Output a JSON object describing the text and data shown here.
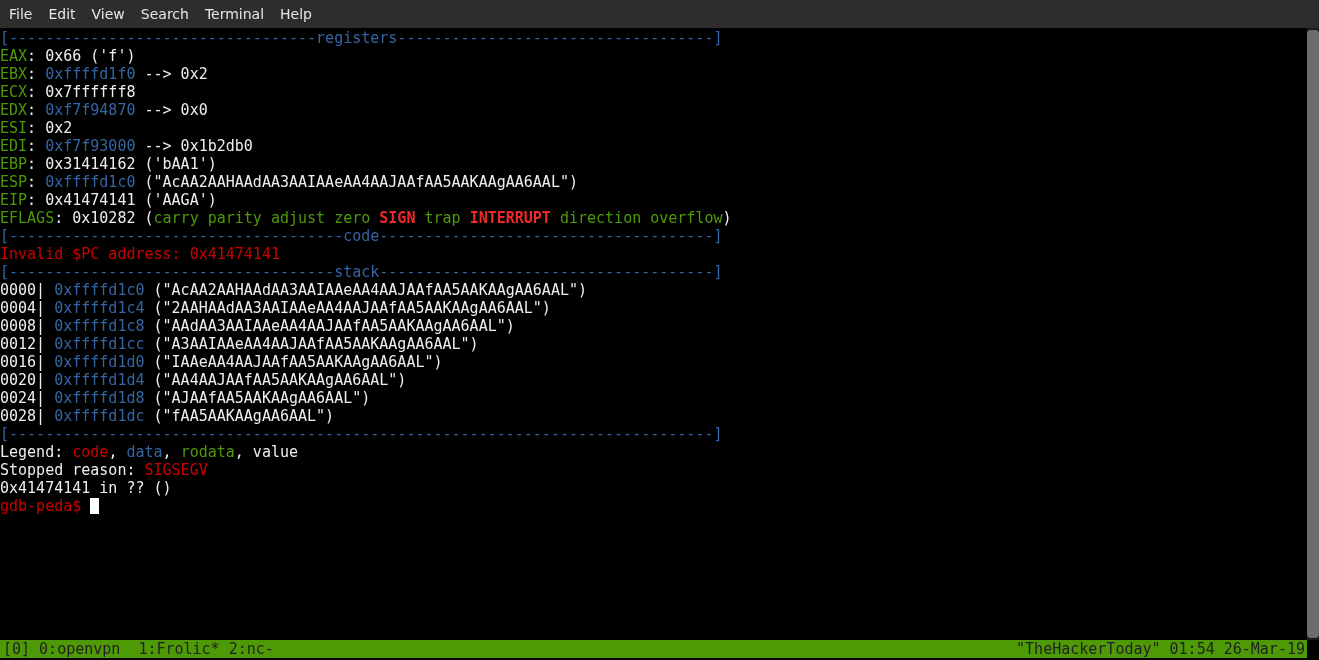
{
  "menu": [
    "File",
    "Edit",
    "View",
    "Search",
    "Terminal",
    "Help"
  ],
  "lines": [
    {
      "kind": "rule",
      "segments": [
        {
          "kind": "data",
          "text": "[----------------------------------"
        },
        {
          "kind": "data",
          "text": "registers"
        },
        {
          "kind": "data",
          "text": "-----------------------------------]"
        }
      ]
    },
    {
      "kind": "text",
      "segments": [
        {
          "kind": "rodata",
          "text": "EAX"
        },
        {
          "kind": "plain",
          "text": ": 0x66 ('f')"
        }
      ]
    },
    {
      "kind": "text",
      "segments": [
        {
          "kind": "rodata",
          "text": "EBX"
        },
        {
          "kind": "plain",
          "text": ": "
        },
        {
          "kind": "data",
          "text": "0xffffd1f0"
        },
        {
          "kind": "plain",
          "text": " --> 0x2"
        }
      ]
    },
    {
      "kind": "text",
      "segments": [
        {
          "kind": "rodata",
          "text": "ECX"
        },
        {
          "kind": "plain",
          "text": ": 0x7ffffff8"
        }
      ]
    },
    {
      "kind": "text",
      "segments": [
        {
          "kind": "rodata",
          "text": "EDX"
        },
        {
          "kind": "plain",
          "text": ": "
        },
        {
          "kind": "data",
          "text": "0xf7f94870"
        },
        {
          "kind": "plain",
          "text": " --> 0x0"
        }
      ]
    },
    {
      "kind": "text",
      "segments": [
        {
          "kind": "rodata",
          "text": "ESI"
        },
        {
          "kind": "plain",
          "text": ": 0x2"
        }
      ]
    },
    {
      "kind": "text",
      "segments": [
        {
          "kind": "rodata",
          "text": "EDI"
        },
        {
          "kind": "plain",
          "text": ": "
        },
        {
          "kind": "data",
          "text": "0xf7f93000"
        },
        {
          "kind": "plain",
          "text": " --> 0x1b2db0"
        }
      ]
    },
    {
      "kind": "text",
      "segments": [
        {
          "kind": "rodata",
          "text": "EBP"
        },
        {
          "kind": "plain",
          "text": ": 0x31414162 ('bAA1')"
        }
      ]
    },
    {
      "kind": "text",
      "segments": [
        {
          "kind": "rodata",
          "text": "ESP"
        },
        {
          "kind": "plain",
          "text": ": "
        },
        {
          "kind": "data",
          "text": "0xffffd1c0"
        },
        {
          "kind": "plain",
          "text": " (\"AcAA2AAHAAdAA3AAIAAeAA4AAJAAfAA5AAKAAgAA6AAL\")"
        }
      ]
    },
    {
      "kind": "text",
      "segments": [
        {
          "kind": "rodata",
          "text": "EIP"
        },
        {
          "kind": "plain",
          "text": ": 0x41474141 ('AAGA')"
        }
      ]
    },
    {
      "kind": "text",
      "segments": [
        {
          "kind": "rodata",
          "text": "EFLAGS"
        },
        {
          "kind": "plain",
          "text": ": 0x10282 ("
        },
        {
          "kind": "rodata",
          "text": "carry parity adjust zero "
        },
        {
          "kind": "flag_set",
          "text": "SIGN"
        },
        {
          "kind": "rodata",
          "text": " trap "
        },
        {
          "kind": "flag_set",
          "text": "INTERRUPT"
        },
        {
          "kind": "rodata",
          "text": " direction overflow"
        },
        {
          "kind": "plain",
          "text": ")"
        }
      ]
    },
    {
      "kind": "rule",
      "segments": [
        {
          "kind": "data",
          "text": "[-------------------------------------"
        },
        {
          "kind": "data",
          "text": "code"
        },
        {
          "kind": "data",
          "text": "-------------------------------------]"
        }
      ]
    },
    {
      "kind": "text",
      "segments": [
        {
          "kind": "code",
          "text": "Invalid $PC address: 0x41474141"
        }
      ]
    },
    {
      "kind": "rule",
      "segments": [
        {
          "kind": "data",
          "text": "[------------------------------------"
        },
        {
          "kind": "data",
          "text": "stack"
        },
        {
          "kind": "data",
          "text": "-------------------------------------]"
        }
      ]
    },
    {
      "kind": "text",
      "segments": [
        {
          "kind": "plain",
          "text": "0000| "
        },
        {
          "kind": "data",
          "text": "0xffffd1c0"
        },
        {
          "kind": "plain",
          "text": " (\"AcAA2AAHAAdAA3AAIAAeAA4AAJAAfAA5AAKAAgAA6AAL\")"
        }
      ]
    },
    {
      "kind": "text",
      "segments": [
        {
          "kind": "plain",
          "text": "0004| "
        },
        {
          "kind": "data",
          "text": "0xffffd1c4"
        },
        {
          "kind": "plain",
          "text": " (\"2AAHAAdAA3AAIAAeAA4AAJAAfAA5AAKAAgAA6AAL\")"
        }
      ]
    },
    {
      "kind": "text",
      "segments": [
        {
          "kind": "plain",
          "text": "0008| "
        },
        {
          "kind": "data",
          "text": "0xffffd1c8"
        },
        {
          "kind": "plain",
          "text": " (\"AAdAA3AAIAAeAA4AAJAAfAA5AAKAAgAA6AAL\")"
        }
      ]
    },
    {
      "kind": "text",
      "segments": [
        {
          "kind": "plain",
          "text": "0012| "
        },
        {
          "kind": "data",
          "text": "0xffffd1cc"
        },
        {
          "kind": "plain",
          "text": " (\"A3AAIAAeAA4AAJAAfAA5AAKAAgAA6AAL\")"
        }
      ]
    },
    {
      "kind": "text",
      "segments": [
        {
          "kind": "plain",
          "text": "0016| "
        },
        {
          "kind": "data",
          "text": "0xffffd1d0"
        },
        {
          "kind": "plain",
          "text": " (\"IAAeAA4AAJAAfAA5AAKAAgAA6AAL\")"
        }
      ]
    },
    {
      "kind": "text",
      "segments": [
        {
          "kind": "plain",
          "text": "0020| "
        },
        {
          "kind": "data",
          "text": "0xffffd1d4"
        },
        {
          "kind": "plain",
          "text": " (\"AA4AAJAAfAA5AAKAAgAA6AAL\")"
        }
      ]
    },
    {
      "kind": "text",
      "segments": [
        {
          "kind": "plain",
          "text": "0024| "
        },
        {
          "kind": "data",
          "text": "0xffffd1d8"
        },
        {
          "kind": "plain",
          "text": " (\"AJAAfAA5AAKAAgAA6AAL\")"
        }
      ]
    },
    {
      "kind": "text",
      "segments": [
        {
          "kind": "plain",
          "text": "0028| "
        },
        {
          "kind": "data",
          "text": "0xffffd1dc"
        },
        {
          "kind": "plain",
          "text": " (\"fAA5AAKAAgAA6AAL\")"
        }
      ]
    },
    {
      "kind": "rule",
      "segments": [
        {
          "kind": "data",
          "text": "[------------------------------------------------------------------------------]"
        }
      ]
    },
    {
      "kind": "text",
      "segments": [
        {
          "kind": "plain",
          "text": "Legend: "
        },
        {
          "kind": "code",
          "text": "code"
        },
        {
          "kind": "plain",
          "text": ", "
        },
        {
          "kind": "data",
          "text": "data"
        },
        {
          "kind": "plain",
          "text": ", "
        },
        {
          "kind": "rodata",
          "text": "rodata"
        },
        {
          "kind": "plain",
          "text": ", value"
        }
      ]
    },
    {
      "kind": "text",
      "segments": [
        {
          "kind": "plain",
          "text": "Stopped reason: "
        },
        {
          "kind": "code",
          "text": "SIGSEGV"
        }
      ]
    },
    {
      "kind": "text",
      "segments": [
        {
          "kind": "plain",
          "text": "0x41474141 in ?? ()"
        }
      ]
    },
    {
      "kind": "prompt",
      "segments": [
        {
          "kind": "code",
          "text": "gdb-peda$"
        }
      ]
    }
  ],
  "status_bar": {
    "session": "[0]",
    "windows": [
      "0:openvpn",
      "1:Frolic*",
      "2:nc-"
    ],
    "host": "\"TheHackerToday\"",
    "time": "01:54",
    "date": "26-Mar-19"
  }
}
